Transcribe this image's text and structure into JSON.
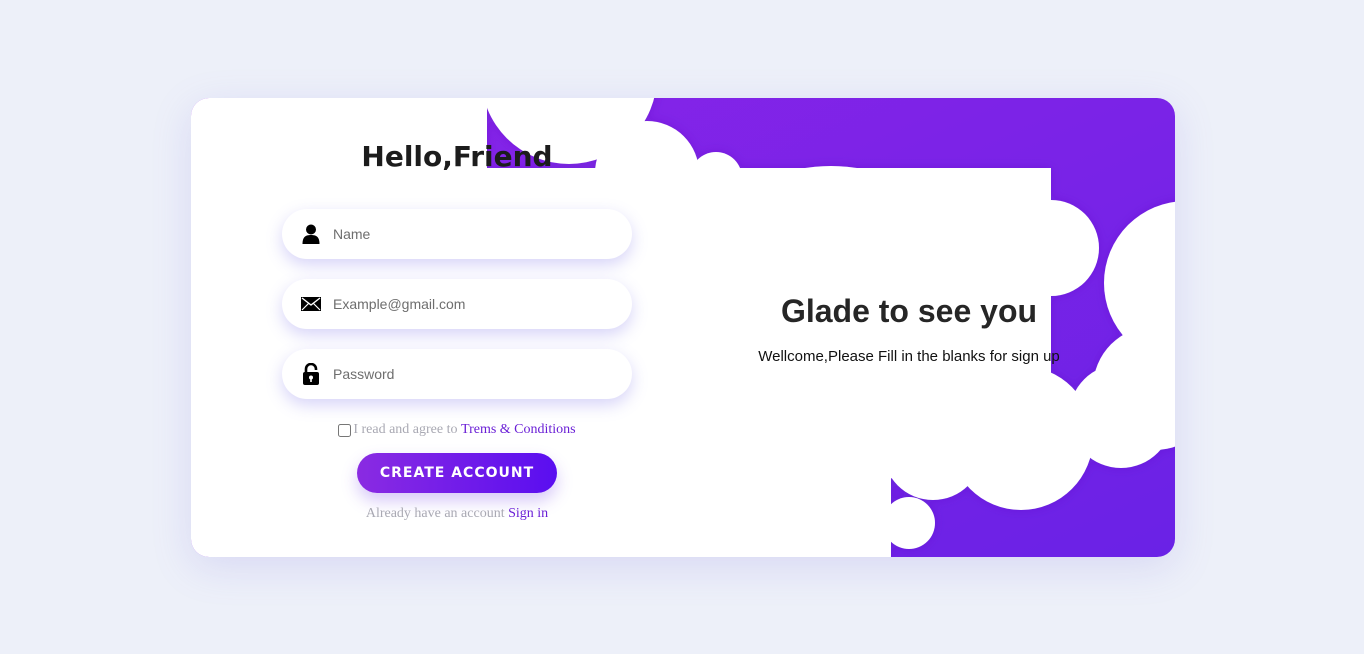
{
  "form": {
    "title": "Hello,Friend",
    "name_placeholder": "Name",
    "email_placeholder": "Example@gmail.com",
    "password_placeholder": "Password",
    "agree_text": "I read and agree to",
    "terms_link": "Trems & Conditions",
    "create_button": "CREATE ACCOUNT",
    "already_text": "Already have an account",
    "signin_link": "Sign in",
    "icons": [
      "user-icon",
      "envelope-icon",
      "unlock-icon"
    ]
  },
  "welcome": {
    "heading": "Glade to see you",
    "subtext": "Wellcome,Please Fill in the blanks for sign up"
  },
  "colors": {
    "background": "#edf0f9",
    "accent_start": "#8a2be2",
    "accent_end": "#5a0ef0",
    "link": "#6a1fd6"
  }
}
